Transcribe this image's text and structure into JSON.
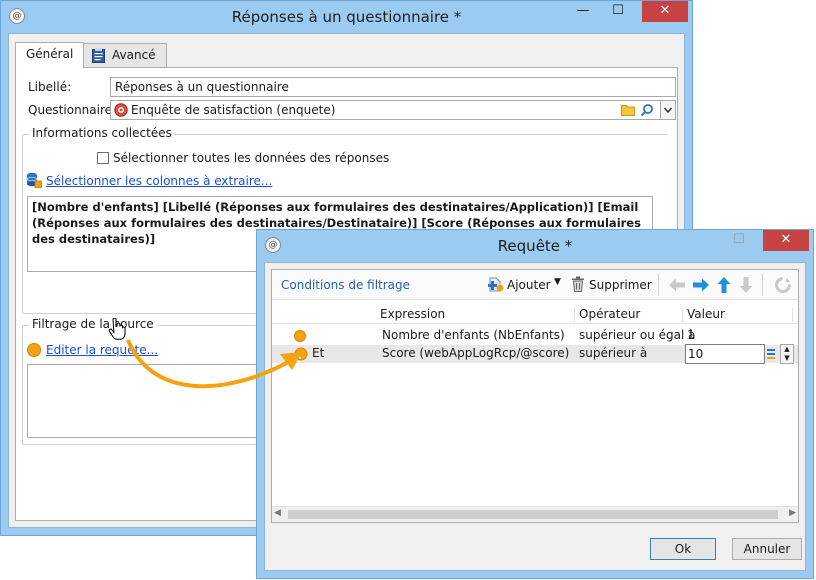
{
  "main_window": {
    "title": "Réponses à un questionnaire *",
    "controls": {
      "minimize": "—",
      "maximize": "☐",
      "close": "✕"
    },
    "tabs": [
      {
        "label": "Général"
      },
      {
        "label": "Avancé"
      }
    ],
    "fields": {
      "libelle_label": "Libellé:",
      "libelle_value": "Réponses à un questionnaire",
      "questionnaire_label": "Questionnaire:",
      "questionnaire_value": "Enquête de satisfaction (enquete)"
    },
    "collected_info": {
      "title": "Informations collectées",
      "select_all_label": "Sélectionner toutes les données des réponses",
      "select_columns_link": "Sélectionner les colonnes à extraire...",
      "columns_text": "[Nombre d'enfants]  [Libellé (Réponses aux formulaires des destinataires/Application)]  [Email (Réponses aux formulaires des destinataires/Destinataire)]  [Score (Réponses aux formulaires des destinataires)]"
    },
    "source_filter": {
      "title": "Filtrage de la source",
      "edit_query_link": "Editer la requête..."
    }
  },
  "query_window": {
    "title": "Requête *",
    "controls": {
      "close": "✕"
    },
    "toolbar": {
      "section_label": "Conditions de filtrage",
      "add_label": "Ajouter",
      "delete_label": "Supprimer"
    },
    "grid": {
      "columns": [
        "Expression",
        "Opérateur",
        "Valeur"
      ],
      "rows": [
        {
          "prefix": "",
          "expression": "Nombre d'enfants (NbEnfants)",
          "operator": "supérieur ou égal à",
          "value": "1"
        },
        {
          "prefix": "Et",
          "expression": "Score (webAppLogRcp/@score)",
          "operator": "supérieur à",
          "value": "10"
        }
      ]
    },
    "buttons": {
      "ok": "Ok",
      "cancel": "Annuler"
    }
  },
  "colors": {
    "window_frame": "#9ccbf2",
    "close_red": "#c74343",
    "accent_orange": "#f5a20f",
    "link_blue": "#1a4fd6",
    "arrow_blue": "#1e90e0"
  }
}
